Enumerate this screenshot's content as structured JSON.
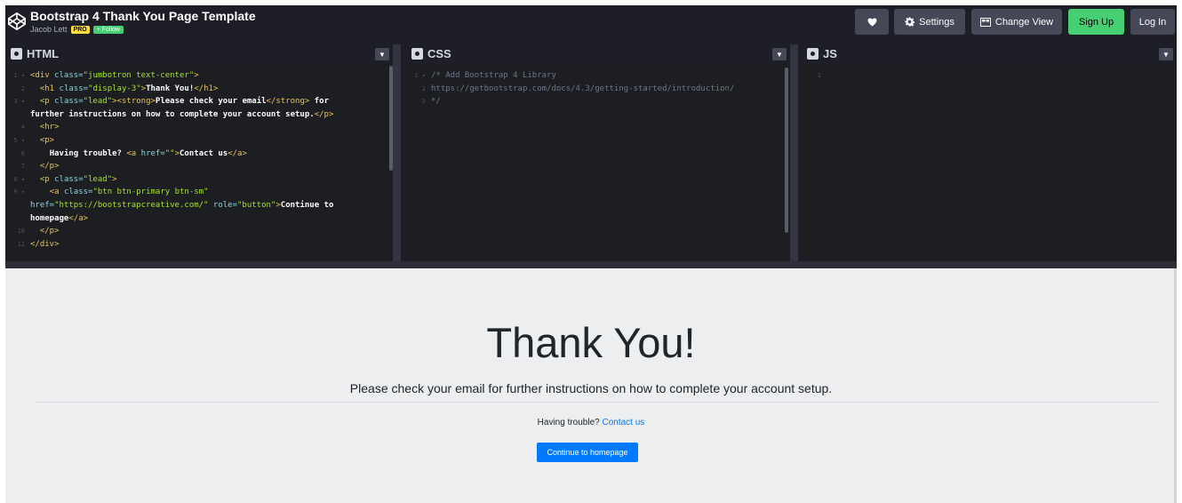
{
  "header": {
    "title": "Bootstrap 4 Thank You Page Template",
    "author": "Jacob Lett",
    "pro_badge": "PRO",
    "follow_label": "+ Follow",
    "settings_label": "Settings",
    "change_view_label": "Change View",
    "signup_label": "Sign Up",
    "login_label": "Log In"
  },
  "panels": {
    "html_label": "HTML",
    "css_label": "CSS",
    "js_label": "JS"
  },
  "html_code": {
    "l1_tag_open": "<div ",
    "l1_attr": "class=",
    "l1_str": "\"jumbotron text-center\"",
    "l1_close": ">",
    "l2_tag": "<h1 ",
    "l2_attr": "class=",
    "l2_str": "\"display-3\"",
    "l2_gt": ">",
    "l2_text": "Thank You!",
    "l2_end": "</h1>",
    "l3_tag": "<p ",
    "l3_attr": "class=",
    "l3_str": "\"lead\"",
    "l3_gt": ">",
    "l3_strong": "<strong>",
    "l3_text": "Please check your email",
    "l3_strong_end": "</strong>",
    "l3_text2": " for",
    "l4_text": "further instructions on how to complete your account setup.",
    "l4_end": "</p>",
    "l5": "<hr>",
    "l6": "<p>",
    "l7_text": "Having trouble? ",
    "l7_tag": "<a ",
    "l7_attr": "href=",
    "l7_str": "\"\"",
    "l7_gt": ">",
    "l7_text2": "Contact us",
    "l7_end": "</a>",
    "l8": "</p>",
    "l9_tag": "<p ",
    "l9_attr": "class=",
    "l9_str": "\"lead\"",
    "l9_gt": ">",
    "l10_tag": "<a ",
    "l10_attr": "class=",
    "l10_str": "\"btn btn-primary btn-sm\"",
    "l11_attr": "href=",
    "l11_str": "\"https://bootstrapcreative.com/\"",
    "l11_attr2": " role=",
    "l11_str2": "\"button\"",
    "l11_gt": ">",
    "l11_text": "Continue to",
    "l12_text": "homepage",
    "l12_end": "</a>",
    "l13": "</p>",
    "l14": "</div>"
  },
  "css_code": {
    "l1": "/* Add Bootstrap 4 Library",
    "l2": "https://getbootstrap.com/docs/4.3/getting-started/introduction/",
    "l3": "*/"
  },
  "preview": {
    "heading": "Thank You!",
    "lead": "Please check your email for further instructions on how to complete your account setup.",
    "trouble_text": "Having trouble?",
    "contact_link": "Contact us",
    "button_label": "Continue to homepage"
  }
}
